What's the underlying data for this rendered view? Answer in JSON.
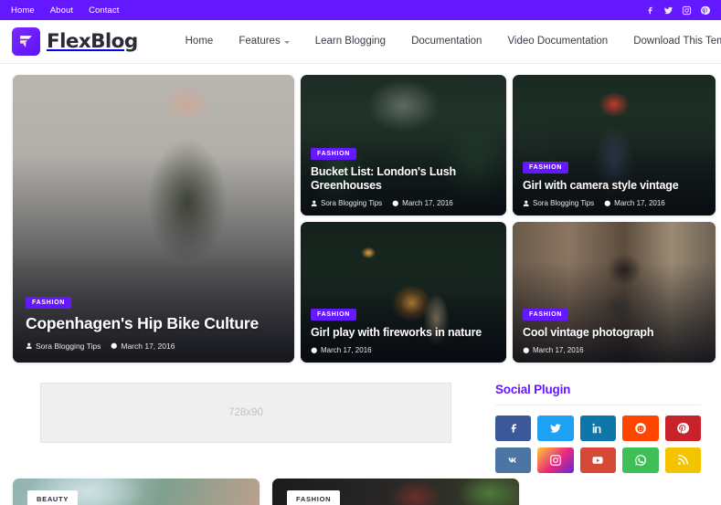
{
  "topbar": {
    "links": [
      {
        "label": "Home"
      },
      {
        "label": "About"
      },
      {
        "label": "Contact"
      }
    ],
    "social": [
      {
        "name": "facebook-icon"
      },
      {
        "name": "twitter-icon"
      },
      {
        "name": "instagram-icon"
      },
      {
        "name": "pinterest-icon"
      }
    ],
    "bg_color": "#6418FF"
  },
  "header": {
    "brand": "FlexBlog",
    "logo_icon": "flexblog-logo-icon",
    "nav": [
      {
        "label": "Home",
        "has_caret": false
      },
      {
        "label": "Features",
        "has_caret": true
      },
      {
        "label": "Learn Blogging",
        "has_caret": false
      },
      {
        "label": "Documentation",
        "has_caret": false
      },
      {
        "label": "Video Documentation",
        "has_caret": false
      },
      {
        "label": "Download This Template",
        "has_caret": false
      }
    ],
    "search_icon": "search-icon"
  },
  "featured": [
    {
      "id": "copenhagen",
      "tag": "FASHION",
      "title": "Copenhagen's Hip Bike Culture",
      "author": "Sora Blogging Tips",
      "date": "March 17, 2016",
      "show_author": true,
      "size": "big"
    },
    {
      "id": "bucket-list",
      "tag": "FASHION",
      "title": "Bucket List: London's Lush Greenhouses",
      "author": "Sora Blogging Tips",
      "date": "March 17, 2016",
      "show_author": true,
      "size": "small"
    },
    {
      "id": "girl-camera",
      "tag": "FASHION",
      "title": "Girl with camera style vintage",
      "author": "Sora Blogging Tips",
      "date": "March 17, 2016",
      "show_author": true,
      "size": "small"
    },
    {
      "id": "fireworks",
      "tag": "FASHION",
      "title": "Girl play with fireworks in nature",
      "author": "",
      "date": "March 17, 2016",
      "show_author": false,
      "size": "small"
    },
    {
      "id": "cool-vintage",
      "tag": "FASHION",
      "title": "Cool vintage photograph",
      "author": "",
      "date": "March 17, 2016",
      "show_author": false,
      "size": "small"
    }
  ],
  "ad": {
    "label": "728x90"
  },
  "sidebar": {
    "widget_title": "Social Plugin",
    "social_buttons": [
      {
        "name": "facebook-icon",
        "color": "#3b5998"
      },
      {
        "name": "twitter-icon",
        "color": "#1da1f2"
      },
      {
        "name": "linkedin-icon",
        "color": "#0e76a8"
      },
      {
        "name": "reddit-icon",
        "color": "#ff4500"
      },
      {
        "name": "pinterest-icon",
        "color": "#c8232c"
      },
      {
        "name": "vk-icon",
        "color": "#4c75a3"
      },
      {
        "name": "instagram-icon",
        "color": "#e1306c"
      },
      {
        "name": "youtube-icon",
        "color": "#d64937"
      },
      {
        "name": "whatsapp-icon",
        "color": "#3ebf57"
      },
      {
        "name": "rss-icon",
        "color": "#f5c400"
      }
    ]
  },
  "bottom_posts": [
    {
      "tag": "BEAUTY"
    },
    {
      "tag": "FASHION"
    }
  ]
}
